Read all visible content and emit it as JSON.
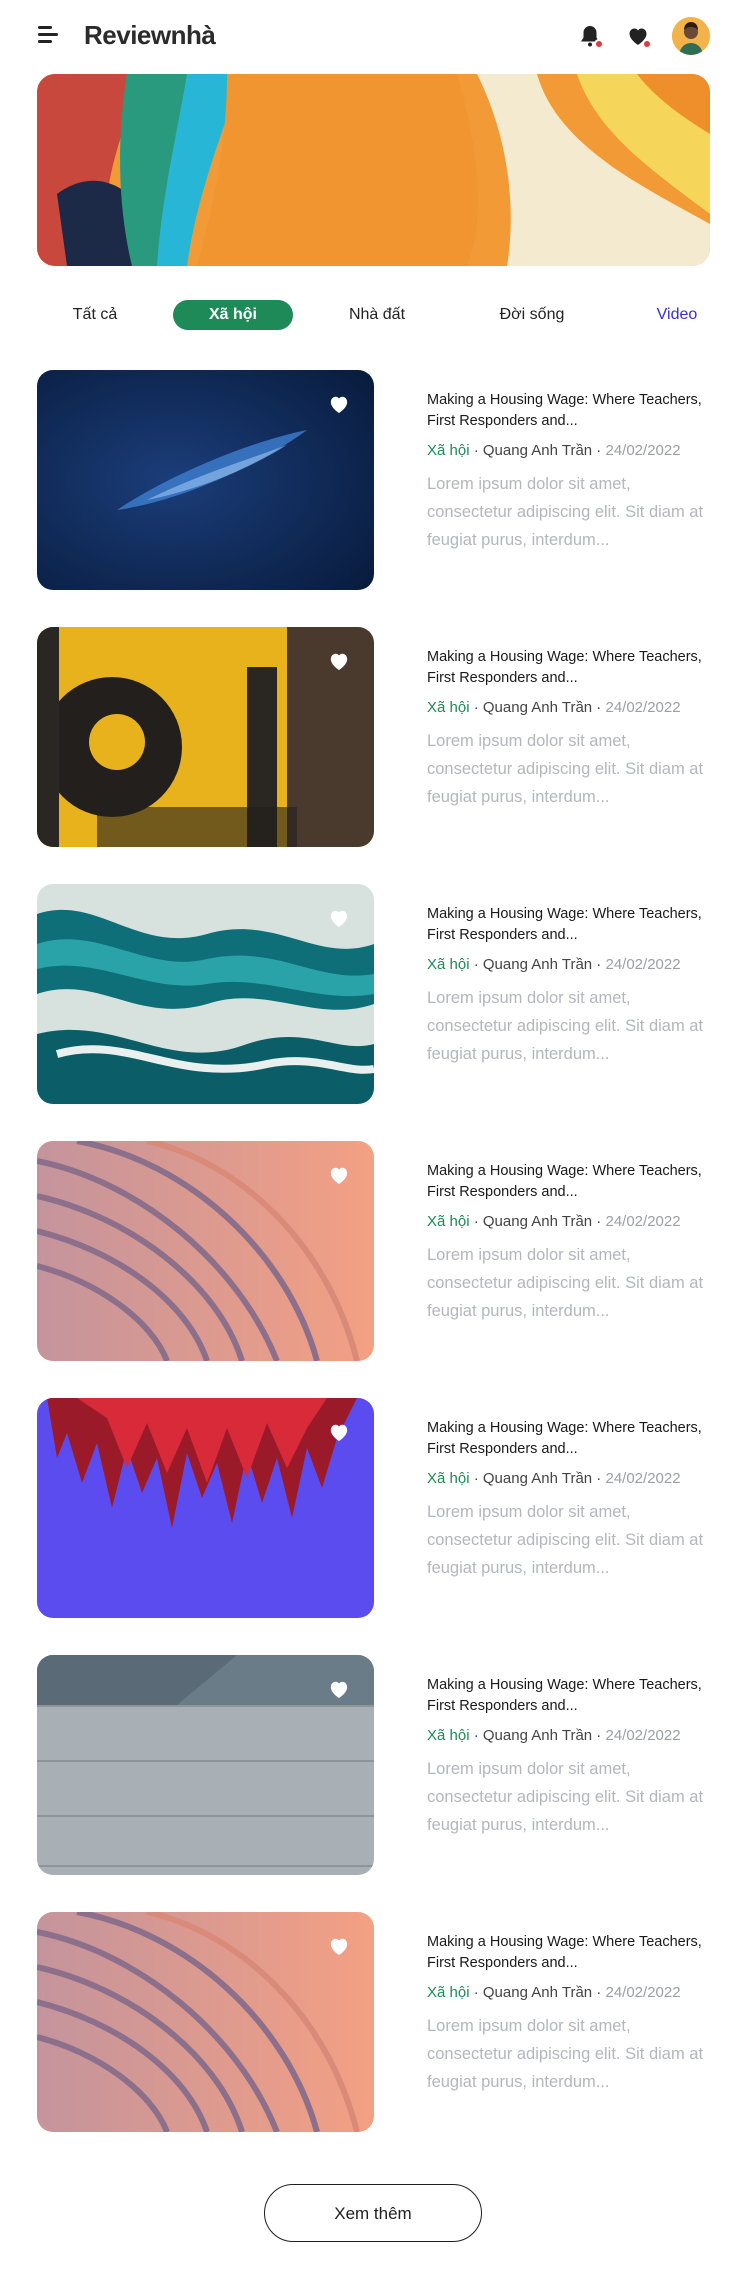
{
  "header": {
    "logo": "Reviewnhà",
    "icons": [
      "menu-icon",
      "bell-icon",
      "heart-icon",
      "avatar"
    ],
    "notification_color": "#e5383b"
  },
  "tabs": [
    {
      "label": "Tất cả",
      "active": false
    },
    {
      "label": "Xã hội",
      "active": true
    },
    {
      "label": "Nhà đất",
      "active": false
    },
    {
      "label": "Đời sống",
      "active": false
    },
    {
      "label": "Video",
      "active": false
    }
  ],
  "colors": {
    "accent": "#1e8a57",
    "video_link": "#3a2dd6",
    "muted_text": "#b3b7bd"
  },
  "articles": [
    {
      "title": "Making a Housing Wage: Where Teachers, First Responders and...",
      "category": "Xã hội",
      "author": "Quang Anh Trần",
      "date": "24/02/2022",
      "excerpt": "Lorem ipsum dolor sit amet, consectetur adipiscing elit. Sit diam at feugiat purus, interdum...",
      "image": "dark-blue-texture"
    },
    {
      "title": "Making a Housing Wage: Where Teachers, First Responders and...",
      "category": "Xã hội",
      "author": "Quang Anh Trần",
      "date": "24/02/2022",
      "excerpt": "Lorem ipsum dolor sit amet, consectetur adipiscing elit. Sit diam at feugiat purus, interdum...",
      "image": "yellow-grunge-wall"
    },
    {
      "title": "Making a Housing Wage: Where Teachers, First Responders and...",
      "category": "Xã hội",
      "author": "Quang Anh Trần",
      "date": "24/02/2022",
      "excerpt": "Lorem ipsum dolor sit amet, consectetur adipiscing elit. Sit diam at feugiat purus, interdum...",
      "image": "teal-marble-swirl"
    },
    {
      "title": "Making a Housing Wage: Where Teachers, First Responders and...",
      "category": "Xã hội",
      "author": "Quang Anh Trần",
      "date": "24/02/2022",
      "excerpt": "Lorem ipsum dolor sit amet, consectetur adipiscing elit. Sit diam at feugiat purus, interdum...",
      "image": "peach-curved-lines"
    },
    {
      "title": "Making a Housing Wage: Where Teachers, First Responders and...",
      "category": "Xã hội",
      "author": "Quang Anh Trần",
      "date": "24/02/2022",
      "excerpt": "Lorem ipsum dolor sit amet, consectetur adipiscing elit. Sit diam at feugiat purus, interdum...",
      "image": "red-spiky-plant-on-purple"
    },
    {
      "title": "Making a Housing Wage: Where Teachers, First Responders and...",
      "category": "Xã hội",
      "author": "Quang Anh Trần",
      "date": "24/02/2022",
      "excerpt": "Lorem ipsum dolor sit amet, consectetur adipiscing elit. Sit diam at feugiat purus, interdum...",
      "image": "grey-concrete-wall"
    },
    {
      "title": "Making a Housing Wage: Where Teachers, First Responders and...",
      "category": "Xã hội",
      "author": "Quang Anh Trần",
      "date": "24/02/2022",
      "excerpt": "Lorem ipsum dolor sit amet, consectetur adipiscing elit. Sit diam at feugiat purus, interdum...",
      "image": "peach-curved-lines"
    }
  ],
  "load_more": {
    "label": "Xem thêm"
  }
}
